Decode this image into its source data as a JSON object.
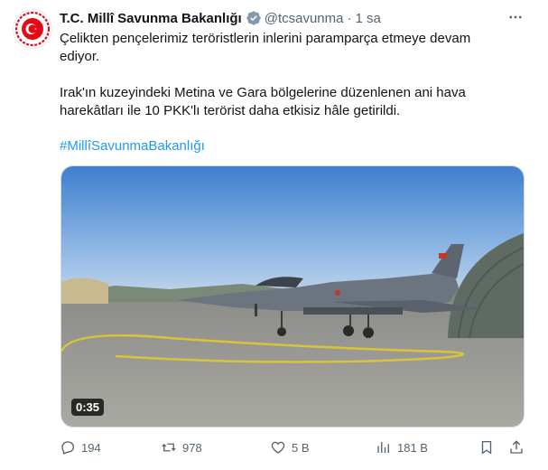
{
  "tweet": {
    "author_name": "T.C. Millî Savunma Bakanlığı",
    "handle": "@tcsavunma",
    "separator": "·",
    "time": "1 sa",
    "text_line1": "Çelikten pençelerimiz teröristlerin inlerini paramparça etmeye devam ediyor.",
    "text_line2": "Irak'ın kuzeyindeki Metina ve Gara bölgelerine düzenlenen ani hava harekâtları ile 10 PKK'lı terörist daha etkisiz hâle getirildi.",
    "hashtag": "#MillîSavunmaBakanlığı"
  },
  "media": {
    "duration": "0:35"
  },
  "actions": {
    "replies": "194",
    "retweets": "978",
    "likes": "5 B",
    "views": "181 B"
  },
  "colors": {
    "link": "#1d9bf0",
    "secondary_text": "#536471",
    "verified_badge": "#829aab",
    "logo_red": "#e30a17"
  },
  "icons": {
    "reply": "reply-icon",
    "retweet": "retweet-icon",
    "like": "heart-icon",
    "views": "views-icon",
    "bookmark": "bookmark-icon",
    "share": "share-icon",
    "more": "more-icon",
    "verified": "verified-badge-icon"
  }
}
